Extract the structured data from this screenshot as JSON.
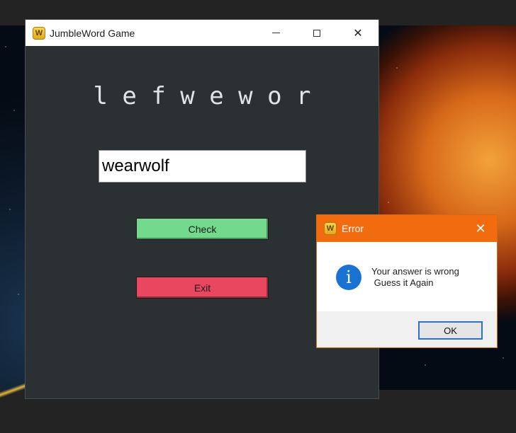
{
  "main_window": {
    "title": "JumbleWord Game",
    "icon_letter": "W",
    "controls": {
      "minimize": "minimize",
      "maximize": "maximize",
      "close": "✕"
    },
    "jumbled_word": "l e f w e w o r",
    "answer_value": "wearwolf",
    "check_label": "Check",
    "exit_label": "Exit",
    "colors": {
      "check": "#72d98d",
      "exit": "#e94660",
      "background": "#2b3033"
    }
  },
  "error_dialog": {
    "title": "Error",
    "icon_letter": "W",
    "close_glyph": "✕",
    "info_glyph": "i",
    "message": "Your answer is wrong\n Guess it Again",
    "ok_label": "OK",
    "colors": {
      "titlebar": "#f26b0f",
      "info": "#1a73d2"
    }
  }
}
